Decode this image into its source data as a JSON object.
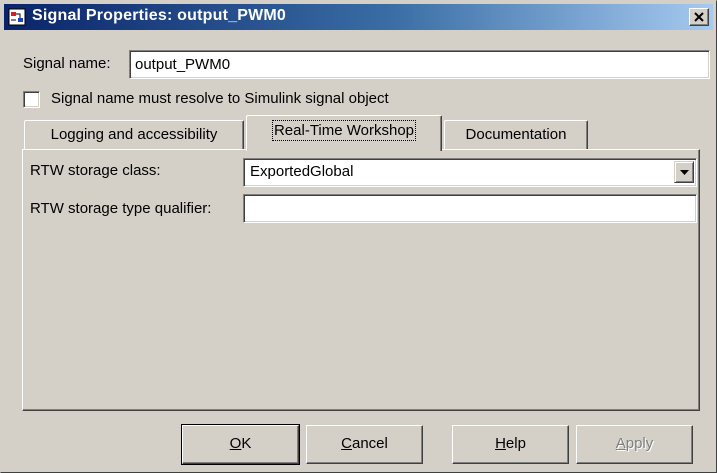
{
  "window": {
    "title": "Signal Properties: output_PWM0"
  },
  "signal_name": {
    "label": "Signal name:",
    "value": "output_PWM0"
  },
  "resolve_checkbox": {
    "label": "Signal name must resolve to Simulink signal object",
    "checked": false
  },
  "tabs": [
    {
      "label": "Logging and accessibility",
      "active": false
    },
    {
      "label": "Real-Time Workshop",
      "active": true
    },
    {
      "label": "Documentation",
      "active": false
    }
  ],
  "rtw": {
    "storage_class_label": "RTW storage class:",
    "storage_class_value": "ExportedGlobal",
    "type_qualifier_label": "RTW storage type qualifier:",
    "type_qualifier_value": ""
  },
  "buttons": {
    "ok": "OK",
    "cancel": "Cancel",
    "help": "Help",
    "apply": "Apply"
  },
  "colors": {
    "face": "#d4d0c8",
    "titlebar_start": "#0a246a",
    "titlebar_end": "#a6caf0"
  },
  "icons": {
    "app": "simulink-block-icon",
    "close": "close-icon",
    "dropdown": "chevron-down-icon"
  }
}
